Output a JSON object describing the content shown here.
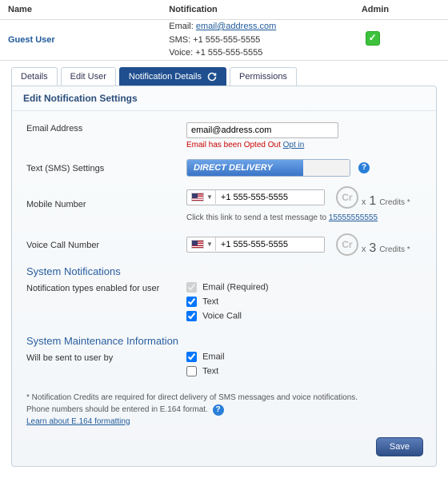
{
  "table": {
    "headers": {
      "name": "Name",
      "notification": "Notification",
      "admin": "Admin"
    },
    "row": {
      "name": "Guest User",
      "email_label": "Email:",
      "email": "email@address.com",
      "sms_label": "SMS:",
      "sms": "+1 555-555-5555",
      "voice_label": "Voice:",
      "voice": "+1 555-555-5555",
      "admin": true
    }
  },
  "tabs": {
    "details": "Details",
    "edit_user": "Edit User",
    "notification_details": "Notification Details",
    "permissions": "Permissions"
  },
  "panel": {
    "title": "Edit Notification Settings",
    "email": {
      "label": "Email Address",
      "value": "email@address.com",
      "opt_msg": "Email has been Opted Out",
      "opt_link": "Opt in"
    },
    "sms": {
      "label": "Text (SMS) Settings",
      "mode": "DIRECT DELIVERY"
    },
    "mobile": {
      "label": "Mobile Number",
      "value": "+1 555-555-5555",
      "credits_num": "1",
      "credits_label": "Credits *",
      "hint_prefix": "Click this link to send a test message to ",
      "hint_link": "15555555555"
    },
    "voice": {
      "label": "Voice Call Number",
      "value": "+1 555-555-5555",
      "credits_num": "3",
      "credits_label": "Credits *"
    },
    "sys_notif": {
      "heading": "System Notifications",
      "subhead": "Notification types enabled for user",
      "opts": {
        "email": "Email (Required)",
        "text": "Text",
        "voice": "Voice Call"
      }
    },
    "sys_maint": {
      "heading": "System Maintenance Information",
      "subhead": "Will be sent to user by",
      "opts": {
        "email": "Email",
        "text": "Text"
      }
    },
    "footnote": {
      "line1": "* Notification Credits are required for direct delivery of SMS messages and voice notifications.",
      "line2": "Phone numbers should be entered in E.164 format.",
      "learn": "Learn about E.164 formatting"
    },
    "save": "Save",
    "credits_token": "Cr",
    "help": "?",
    "x": "x"
  }
}
